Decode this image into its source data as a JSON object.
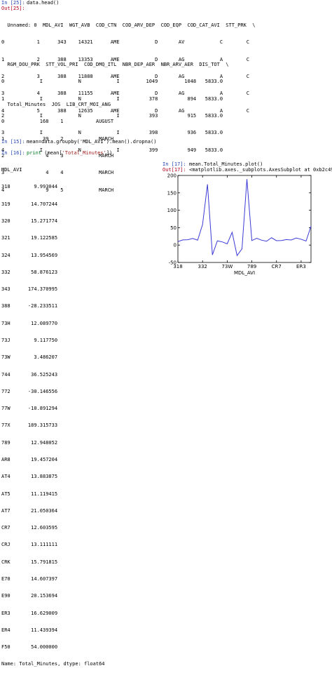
{
  "cells": {
    "c25": {
      "in_prompt": "In [25]:",
      "code": "data.head()",
      "out_prompt": "Out[25]:",
      "table1_lines": [
        "  Unnamed: 0  MDL_AVI  WGT_AVB  COD_CTN  COD_ARV_DEP  COD_EQP  COD_CAT_AVI  STT_PRK  \\",
        "0           1      343    14321      AME            D       AV            C        C",
        "1           2      388    13353      AME            D       AG            A        C",
        "2           3      388    11888      AME            D       AG            A        C",
        "3           4      388    11155      AME            D       AG            A        C",
        "4           5      388    12635      AME            D       AG            A        C"
      ],
      "table2_lines": [
        "  RGM_DOU_PRK  STT_VOL_PRI  COD_DMQ_ITL  NBR_DEP_AER  NBR_ARV_AER  DIS_TOT  \\",
        "0            I            N            I         1049         1048   5833.0",
        "1            I            N            I          378          894   5833.0",
        "2            I            N            I          393          915   5833.0",
        "3            I            N            I          398          936   5833.0",
        "4            I            N            I          399          949   5833.0"
      ],
      "table3_lines": [
        "  Total_Minutes  JOS  LIB_CRT_MOI_ANG",
        "0            168    1           AUGUST",
        "1             39    2            MARCH",
        "2              4    3            MARCH",
        "3              4    4            MARCH",
        "4              9    5            MARCH"
      ]
    },
    "c15": {
      "in_prompt": "In [15]:",
      "code": "mean=data.groupby('MDL_AVI').mean().dropna()"
    },
    "c16": {
      "in_prompt": "In [16]:",
      "code_kw": "print",
      "code_open": " (mean[",
      "code_str": "'Total_Minutes'",
      "code_close": "])",
      "output_lines": [
        "MDL_AVI",
        "318        9.993044",
        "319       14.707244",
        "320       15.271774",
        "321       19.122585",
        "324       13.954569",
        "332       58.876123",
        "343      174.370995",
        "388      -28.233511",
        "73H       12.089770",
        "73J        9.117750",
        "73W        3.486207",
        "744       36.525243",
        "772      -30.146556",
        "77W      -10.891294",
        "77X      189.315733",
        "789       12.948052",
        "AR8       19.457204",
        "AT4       13.883875",
        "AT5       11.119415",
        "AT7       21.050364",
        "CR7       12.603595",
        "CRJ       13.111111",
        "CRK       15.791815",
        "E70       14.607397",
        "E90       20.153694",
        "ER3       16.629009",
        "ER4       11.439394",
        "F50       54.000000",
        "Name: Total_Minutes, dtype: float64"
      ]
    },
    "c17": {
      "in_prompt": "In [17]:",
      "code": "mean.Total_Minutes.plot()",
      "out_prompt": "Out[17]:",
      "output_text": "<matplotlib.axes._subplots.AxesSubplot at 0xb2c49b0>"
    }
  },
  "chart_data": {
    "type": "line",
    "x": [
      "318",
      "319",
      "320",
      "321",
      "324",
      "332",
      "343",
      "388",
      "73H",
      "73J",
      "73W",
      "744",
      "772",
      "77W",
      "77X",
      "789",
      "AR8",
      "AT4",
      "AT5",
      "AT7",
      "CR7",
      "CRJ",
      "CRK",
      "E70",
      "E90",
      "ER3",
      "ER4",
      "F50"
    ],
    "values": [
      9.993044,
      14.707244,
      15.271774,
      19.122585,
      13.954569,
      58.876123,
      174.370995,
      -28.233511,
      12.08977,
      9.11775,
      3.486207,
      36.525243,
      -30.146556,
      -10.891294,
      189.315733,
      12.948052,
      19.457204,
      13.883875,
      11.119415,
      21.050364,
      12.603595,
      13.111111,
      15.791815,
      14.607397,
      20.153694,
      16.629009,
      11.439394,
      54.0
    ],
    "xtick_labels": [
      "318",
      "332",
      "73W",
      "789",
      "CR7",
      "ER3"
    ],
    "xtick_positions": [
      0,
      5,
      10,
      15,
      20,
      25
    ],
    "ytick_values": [
      -50,
      0,
      50,
      100,
      150,
      200
    ],
    "ylim": [
      -50,
      200
    ],
    "xlabel": "MDL_AVI",
    "ylabel": "",
    "title": "",
    "line_color": "#3b3bd6",
    "grid": false
  }
}
